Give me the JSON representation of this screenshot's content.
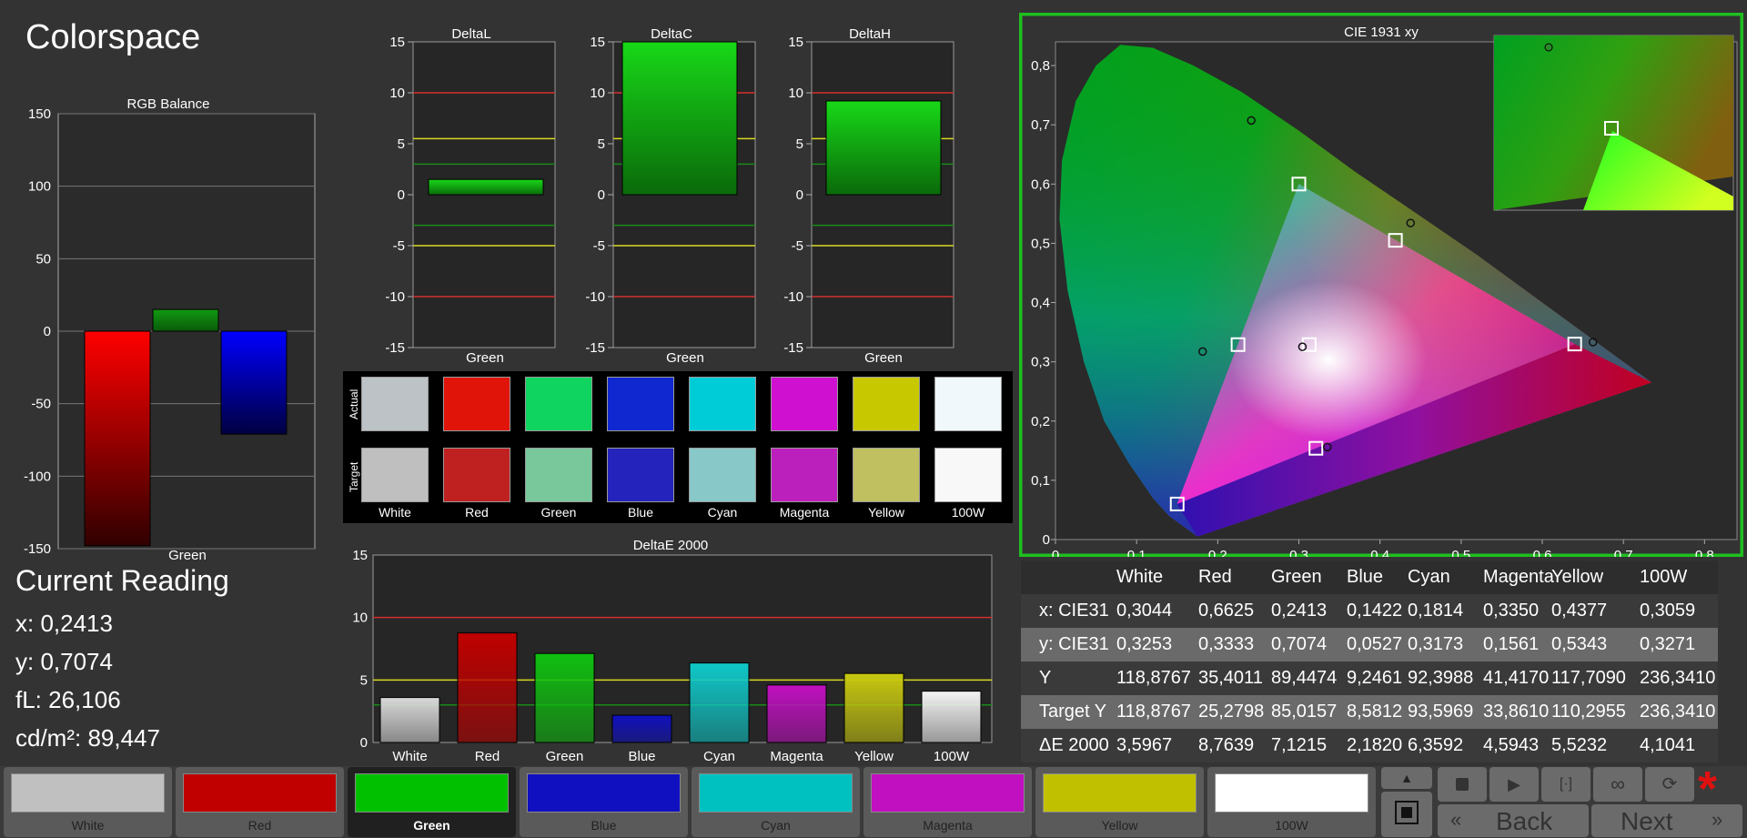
{
  "page_title": "Colorspace",
  "colors": {
    "accent_green": "#1fbf1f",
    "ref_red": "#d23030",
    "ref_yellow": "#d8d820"
  },
  "chart_data": [
    {
      "type": "bar",
      "title": "RGB Balance",
      "categories": [
        "Green"
      ],
      "series": [
        {
          "name": "Red",
          "color": "#ff0000",
          "values": [
            -148
          ]
        },
        {
          "name": "Green",
          "color": "#119911",
          "values": [
            15
          ]
        },
        {
          "name": "Blue",
          "color": "#0000ff",
          "values": [
            -71
          ]
        }
      ],
      "yticks": [
        "150",
        "100",
        "50",
        "0",
        "-50",
        "-100",
        "-150"
      ],
      "ylim": [
        -150,
        150
      ]
    },
    {
      "type": "bar",
      "title": "DeltaL",
      "categories": [
        "Green"
      ],
      "values": [
        1.5
      ],
      "yticks": [
        "15",
        "10",
        "5",
        "0",
        "-5",
        "-10",
        "-15"
      ],
      "ylim": [
        -15,
        15
      ]
    },
    {
      "type": "bar",
      "title": "DeltaC",
      "categories": [
        "Green"
      ],
      "values": [
        15
      ],
      "yticks": [
        "15",
        "10",
        "5",
        "0",
        "-5",
        "-10",
        "-15"
      ],
      "ylim": [
        -15,
        15
      ]
    },
    {
      "type": "bar",
      "title": "DeltaH",
      "categories": [
        "Green"
      ],
      "values": [
        9.2
      ],
      "yticks": [
        "15",
        "10",
        "5",
        "0",
        "-5",
        "-10",
        "-15"
      ],
      "ylim": [
        -15,
        15
      ]
    },
    {
      "type": "bar",
      "title": "DeltaE 2000",
      "categories": [
        "White",
        "Red",
        "Green",
        "Blue",
        "Cyan",
        "Magenta",
        "Yellow",
        "100W"
      ],
      "values": [
        3.5967,
        8.7639,
        7.1215,
        2.182,
        6.3592,
        4.5943,
        5.5232,
        4.1041
      ],
      "colors": [
        "#d8d8d8",
        "#c00000",
        "#10c010",
        "#1010c0",
        "#10c8c8",
        "#c010c0",
        "#c8c810",
        "#f4f4f4"
      ],
      "yticks": [
        "15",
        "10",
        "5",
        "0"
      ],
      "ylim": [
        0,
        15
      ]
    },
    {
      "type": "scatter",
      "title": "CIE 1931 xy",
      "xticks": [
        "0",
        "0,1",
        "0,2",
        "0,3",
        "0,4",
        "0,5",
        "0,6",
        "0,7",
        "0,8"
      ],
      "yticks": [
        "0",
        "0,1",
        "0,2",
        "0,3",
        "0,4",
        "0,5",
        "0,6",
        "0,7",
        "0,8"
      ],
      "xlim": [
        0,
        0.84
      ],
      "ylim": [
        0,
        0.84
      ],
      "targets": [
        [
          0.64,
          0.33
        ],
        [
          0.3,
          0.6
        ],
        [
          0.15,
          0.06
        ],
        [
          0.225,
          0.329
        ],
        [
          0.321,
          0.154
        ],
        [
          0.419,
          0.505
        ],
        [
          0.3127,
          0.329
        ]
      ],
      "measured": [
        [
          0.6625,
          0.3333
        ],
        [
          0.2413,
          0.7074
        ],
        [
          0.1814,
          0.3173
        ],
        [
          0.335,
          0.1561
        ],
        [
          0.4377,
          0.5343
        ],
        [
          0.3044,
          0.3253
        ]
      ]
    }
  ],
  "swatches": {
    "row_labels": [
      "Actual",
      "Target"
    ],
    "labels": [
      "White",
      "Red",
      "Green",
      "Blue",
      "Cyan",
      "Magenta",
      "Yellow",
      "100W"
    ],
    "actual": [
      "#bcc2c6",
      "#e01408",
      "#10d460",
      "#1028d0",
      "#00ccd8",
      "#d010d0",
      "#c8c800",
      "#f0f8fc"
    ],
    "target": [
      "#bfbfbf",
      "#bf2020",
      "#78c89c",
      "#2424bc",
      "#88c8c8",
      "#bc20bc",
      "#c0c060",
      "#f8f8f8"
    ]
  },
  "current_reading": {
    "title": "Current Reading",
    "x": "x: 0,2413",
    "y": "y: 0,7074",
    "fl": "fL: 26,106",
    "cd": "cd/m²: 89,447"
  },
  "table": {
    "headers": [
      "White",
      "Red",
      "Green",
      "Blue",
      "Cyan",
      "Magenta",
      "Yellow",
      "100W"
    ],
    "rows": [
      {
        "label": "x: CIE31",
        "values": [
          "0,3044",
          "0,6625",
          "0,2413",
          "0,1422",
          "0,1814",
          "0,3350",
          "0,4377",
          "0,3059"
        ]
      },
      {
        "label": "y: CIE31",
        "values": [
          "0,3253",
          "0,3333",
          "0,7074",
          "0,0527",
          "0,3173",
          "0,1561",
          "0,5343",
          "0,3271"
        ]
      },
      {
        "label": "Y",
        "values": [
          "118,8767",
          "35,4011",
          "89,4474",
          "9,2461",
          "92,3988",
          "41,4170",
          "117,7090",
          "236,3410"
        ]
      },
      {
        "label": "Target Y",
        "values": [
          "118,8767",
          "25,2798",
          "85,0157",
          "8,5812",
          "93,5969",
          "33,8610",
          "110,2955",
          "236,3410"
        ]
      },
      {
        "label": "ΔE 2000",
        "values": [
          "3,5967",
          "8,7639",
          "7,1215",
          "2,1820",
          "6,3592",
          "4,5943",
          "5,5232",
          "4,1041"
        ]
      }
    ]
  },
  "patch_buttons": [
    {
      "label": "White",
      "color": "#c0c0c0"
    },
    {
      "label": "Red",
      "color": "#c00000"
    },
    {
      "label": "Green",
      "color": "#00c000",
      "selected": true
    },
    {
      "label": "Blue",
      "color": "#1010c0"
    },
    {
      "label": "Cyan",
      "color": "#00c0c0"
    },
    {
      "label": "Magenta",
      "color": "#c010c0"
    },
    {
      "label": "Yellow",
      "color": "#c0c000"
    },
    {
      "label": "100W",
      "color": "#ffffff"
    }
  ],
  "controls": {
    "back_label": "Back",
    "next_label": "Next",
    "icons": [
      "up-arrow-icon",
      "stop-icon",
      "play-icon",
      "step-icon",
      "loop-icon",
      "refresh-icon",
      "asterisk-icon"
    ]
  }
}
